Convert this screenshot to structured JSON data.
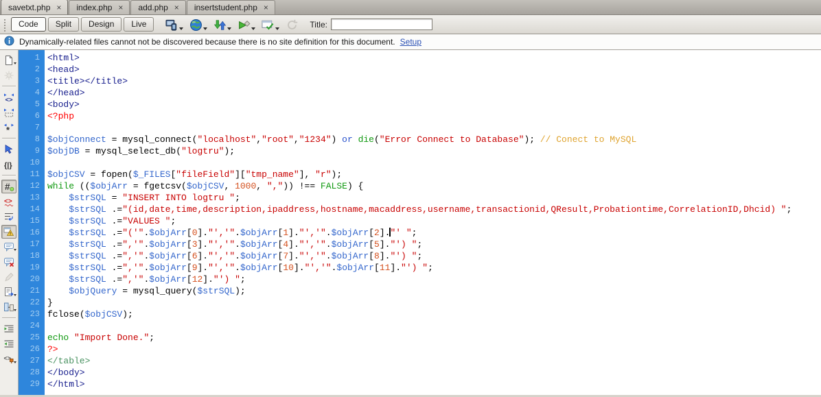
{
  "tabs": [
    {
      "label": "savetxt.php",
      "active": true
    },
    {
      "label": "index.php",
      "active": false
    },
    {
      "label": "add.php",
      "active": false
    },
    {
      "label": "insertstudent.php",
      "active": false
    }
  ],
  "toolbar": {
    "modes": [
      {
        "label": "Code",
        "active": true
      },
      {
        "label": "Split",
        "active": false
      },
      {
        "label": "Design",
        "active": false
      },
      {
        "label": "Live",
        "active": false
      }
    ],
    "icons": [
      {
        "icon": "multiscreen",
        "name": "multiscreen-preview-icon",
        "dropdown": true
      },
      {
        "icon": "globe",
        "name": "preview-in-browser-icon",
        "dropdown": true
      },
      {
        "icon": "updown",
        "name": "file-management-icon",
        "dropdown": true
      },
      {
        "icon": "liveopts",
        "name": "live-view-options-icon",
        "dropdown": true
      },
      {
        "icon": "checkwin",
        "name": "check-browser-compatibility-icon",
        "dropdown": true
      },
      {
        "icon": "refresh",
        "name": "refresh-icon",
        "disabled": true
      }
    ],
    "title_label": "Title:",
    "title_value": "",
    "title_placeholder": ""
  },
  "infobar": {
    "message": "Dynamically-related files cannot not be discovered because there is no site definition for this document.",
    "link": "Setup"
  },
  "coding_toolbar": [
    {
      "icon": "document",
      "name": "open-documents-icon",
      "dropdown": true
    },
    {
      "icon": "gear",
      "name": "live-code-icon",
      "disabled": true
    },
    {
      "sep": true
    },
    {
      "icon": "collapse-tag",
      "name": "collapse-full-tag-icon"
    },
    {
      "icon": "collapse-sel",
      "name": "collapse-selection-icon"
    },
    {
      "icon": "expand-all",
      "name": "expand-all-icon"
    },
    {
      "sep": true
    },
    {
      "icon": "select-parent",
      "name": "select-parent-tag-icon"
    },
    {
      "icon": "braces",
      "name": "balance-braces-icon"
    },
    {
      "sep": true
    },
    {
      "icon": "hash",
      "name": "line-numbers-icon",
      "pressed": true
    },
    {
      "icon": "invalid",
      "name": "highlight-invalid-code-icon"
    },
    {
      "icon": "word-wrap",
      "name": "word-wrap-icon"
    },
    {
      "icon": "warning",
      "name": "syntax-error-alerts-icon",
      "pressed": true
    },
    {
      "icon": "comment",
      "name": "apply-comment-icon",
      "dropdown": true
    },
    {
      "icon": "comment-remove",
      "name": "remove-comment-icon"
    },
    {
      "icon": "pencil",
      "name": "wrap-tag-icon",
      "disabled": true
    },
    {
      "icon": "snippet",
      "name": "recent-snippets-icon",
      "dropdown": true
    },
    {
      "icon": "css-move",
      "name": "move-convert-css-icon",
      "dropdown": true
    },
    {
      "sep": true
    },
    {
      "icon": "indent",
      "name": "indent-code-icon"
    },
    {
      "icon": "outdent",
      "name": "outdent-code-icon"
    },
    {
      "icon": "format",
      "name": "format-source-code-icon",
      "dropdown": true
    }
  ],
  "editor": {
    "gutter_bg": "#2e86dc",
    "gutter_text": "#a3cdf1",
    "token_colors": {
      "t": "#151c8c",
      "g": "#47915f",
      "d": "#ff0000",
      "v": "#3366cc",
      "b": "#2952cc",
      "s": "#c80000",
      "k": "#119911",
      "f": "#000000",
      "n": "#d4501e",
      "c": "#dfa32e",
      "p": "#000000"
    },
    "lines": [
      [
        [
          "t",
          "<html>"
        ]
      ],
      [
        [
          "t",
          "<head>"
        ]
      ],
      [
        [
          "t",
          "<title></title>"
        ]
      ],
      [
        [
          "t",
          "</head>"
        ]
      ],
      [
        [
          "t",
          "<body>"
        ]
      ],
      [
        [
          "d",
          "<?php"
        ]
      ],
      [],
      [
        [
          "v",
          "$objConnect"
        ],
        [
          "p",
          " = "
        ],
        [
          "f",
          "mysql_connect"
        ],
        [
          "p",
          "("
        ],
        [
          "s",
          "\"localhost\""
        ],
        [
          "p",
          ","
        ],
        [
          "s",
          "\"root\""
        ],
        [
          "p",
          ","
        ],
        [
          "s",
          "\"1234\""
        ],
        [
          "p",
          ") "
        ],
        [
          "b",
          "or"
        ],
        [
          "p",
          " "
        ],
        [
          "k",
          "die"
        ],
        [
          "p",
          "("
        ],
        [
          "s",
          "\"Error Connect to Database\""
        ],
        [
          "p",
          "); "
        ],
        [
          "c",
          "// Conect to MySQL"
        ]
      ],
      [
        [
          "v",
          "$objDB"
        ],
        [
          "p",
          " = "
        ],
        [
          "f",
          "mysql_select_db"
        ],
        [
          "p",
          "("
        ],
        [
          "s",
          "\"logtru\""
        ],
        [
          "p",
          ");"
        ]
      ],
      [],
      [
        [
          "v",
          "$objCSV"
        ],
        [
          "p",
          " = "
        ],
        [
          "f",
          "fopen"
        ],
        [
          "p",
          "("
        ],
        [
          "v",
          "$_FILES"
        ],
        [
          "p",
          "["
        ],
        [
          "s",
          "\"fileField\""
        ],
        [
          "p",
          "]["
        ],
        [
          "s",
          "\"tmp_name\""
        ],
        [
          "p",
          "], "
        ],
        [
          "s",
          "\"r\""
        ],
        [
          "p",
          ");"
        ]
      ],
      [
        [
          "k",
          "while"
        ],
        [
          "p",
          " (("
        ],
        [
          "v",
          "$objArr"
        ],
        [
          "p",
          " = "
        ],
        [
          "f",
          "fgetcsv"
        ],
        [
          "p",
          "("
        ],
        [
          "v",
          "$objCSV"
        ],
        [
          "p",
          ", "
        ],
        [
          "n",
          "1000"
        ],
        [
          "p",
          ", "
        ],
        [
          "s",
          "\",\""
        ],
        [
          "p",
          ")) !== "
        ],
        [
          "k",
          "FALSE"
        ],
        [
          "p",
          ") {"
        ]
      ],
      [
        [
          "p",
          "    "
        ],
        [
          "v",
          "$strSQL"
        ],
        [
          "p",
          " = "
        ],
        [
          "s",
          "\"INSERT INTO logtru \""
        ],
        [
          "p",
          ";"
        ]
      ],
      [
        [
          "p",
          "    "
        ],
        [
          "v",
          "$strSQL"
        ],
        [
          "p",
          " .="
        ],
        [
          "s",
          "\"(id,date,time,description,ipaddress,hostname,macaddress,username,transactionid,QResult,Probationtime,CorrelationID,Dhcid) \""
        ],
        [
          "p",
          ";"
        ]
      ],
      [
        [
          "p",
          "    "
        ],
        [
          "v",
          "$strSQL"
        ],
        [
          "p",
          " .="
        ],
        [
          "s",
          "\"VALUES \""
        ],
        [
          "p",
          ";"
        ]
      ],
      [
        [
          "p",
          "    "
        ],
        [
          "v",
          "$strSQL"
        ],
        [
          "p",
          " .="
        ],
        [
          "s",
          "\"('\""
        ],
        [
          "p",
          "."
        ],
        [
          "v",
          "$objArr"
        ],
        [
          "p",
          "["
        ],
        [
          "n",
          "0"
        ],
        [
          "p",
          "]."
        ],
        [
          "s",
          "\"','\""
        ],
        [
          "p",
          "."
        ],
        [
          "v",
          "$objArr"
        ],
        [
          "p",
          "["
        ],
        [
          "n",
          "1"
        ],
        [
          "p",
          "]."
        ],
        [
          "s",
          "\"','\""
        ],
        [
          "p",
          "."
        ],
        [
          "v",
          "$objArr"
        ],
        [
          "p",
          "["
        ],
        [
          "n",
          "2"
        ],
        [
          "p",
          "]."
        ],
        [
          "x",
          ""
        ],
        [
          "s",
          "\"' \""
        ],
        [
          "p",
          ";"
        ]
      ],
      [
        [
          "p",
          "    "
        ],
        [
          "v",
          "$strSQL"
        ],
        [
          "p",
          " .="
        ],
        [
          "s",
          "\",'\""
        ],
        [
          "p",
          "."
        ],
        [
          "v",
          "$objArr"
        ],
        [
          "p",
          "["
        ],
        [
          "n",
          "3"
        ],
        [
          "p",
          "]."
        ],
        [
          "s",
          "\"','\""
        ],
        [
          "p",
          "."
        ],
        [
          "v",
          "$objArr"
        ],
        [
          "p",
          "["
        ],
        [
          "n",
          "4"
        ],
        [
          "p",
          "]."
        ],
        [
          "s",
          "\"','\""
        ],
        [
          "p",
          "."
        ],
        [
          "v",
          "$objArr"
        ],
        [
          "p",
          "["
        ],
        [
          "n",
          "5"
        ],
        [
          "p",
          "]."
        ],
        [
          "s",
          "\"') \""
        ],
        [
          "p",
          ";"
        ]
      ],
      [
        [
          "p",
          "    "
        ],
        [
          "v",
          "$strSQL"
        ],
        [
          "p",
          " .="
        ],
        [
          "s",
          "\",'\""
        ],
        [
          "p",
          "."
        ],
        [
          "v",
          "$objArr"
        ],
        [
          "p",
          "["
        ],
        [
          "n",
          "6"
        ],
        [
          "p",
          "]."
        ],
        [
          "s",
          "\"','\""
        ],
        [
          "p",
          "."
        ],
        [
          "v",
          "$objArr"
        ],
        [
          "p",
          "["
        ],
        [
          "n",
          "7"
        ],
        [
          "p",
          "]."
        ],
        [
          "s",
          "\"','\""
        ],
        [
          "p",
          "."
        ],
        [
          "v",
          "$objArr"
        ],
        [
          "p",
          "["
        ],
        [
          "n",
          "8"
        ],
        [
          "p",
          "]."
        ],
        [
          "s",
          "\"') \""
        ],
        [
          "p",
          ";"
        ]
      ],
      [
        [
          "p",
          "    "
        ],
        [
          "v",
          "$strSQL"
        ],
        [
          "p",
          " .="
        ],
        [
          "s",
          "\",'\""
        ],
        [
          "p",
          "."
        ],
        [
          "v",
          "$objArr"
        ],
        [
          "p",
          "["
        ],
        [
          "n",
          "9"
        ],
        [
          "p",
          "]."
        ],
        [
          "s",
          "\"','\""
        ],
        [
          "p",
          "."
        ],
        [
          "v",
          "$objArr"
        ],
        [
          "p",
          "["
        ],
        [
          "n",
          "10"
        ],
        [
          "p",
          "]."
        ],
        [
          "s",
          "\"','\""
        ],
        [
          "p",
          "."
        ],
        [
          "v",
          "$objArr"
        ],
        [
          "p",
          "["
        ],
        [
          "n",
          "11"
        ],
        [
          "p",
          "]."
        ],
        [
          "s",
          "\"') \""
        ],
        [
          "p",
          ";"
        ]
      ],
      [
        [
          "p",
          "    "
        ],
        [
          "v",
          "$strSQL"
        ],
        [
          "p",
          " .="
        ],
        [
          "s",
          "\",'\""
        ],
        [
          "p",
          "."
        ],
        [
          "v",
          "$objArr"
        ],
        [
          "p",
          "["
        ],
        [
          "n",
          "12"
        ],
        [
          "p",
          "]."
        ],
        [
          "s",
          "\"') \""
        ],
        [
          "p",
          ";"
        ]
      ],
      [
        [
          "p",
          "    "
        ],
        [
          "v",
          "$objQuery"
        ],
        [
          "p",
          " = "
        ],
        [
          "f",
          "mysql_query"
        ],
        [
          "p",
          "("
        ],
        [
          "v",
          "$strSQL"
        ],
        [
          "p",
          ");"
        ]
      ],
      [
        [
          "p",
          "}"
        ]
      ],
      [
        [
          "f",
          "fclose"
        ],
        [
          "p",
          "("
        ],
        [
          "v",
          "$objCSV"
        ],
        [
          "p",
          ");"
        ]
      ],
      [],
      [
        [
          "k",
          "echo"
        ],
        [
          "p",
          " "
        ],
        [
          "s",
          "\"Import Done.\""
        ],
        [
          "p",
          ";"
        ]
      ],
      [
        [
          "d",
          "?>"
        ]
      ],
      [
        [
          "g",
          "</table>"
        ]
      ],
      [
        [
          "t",
          "</body>"
        ]
      ],
      [
        [
          "t",
          "</html>"
        ]
      ]
    ]
  }
}
